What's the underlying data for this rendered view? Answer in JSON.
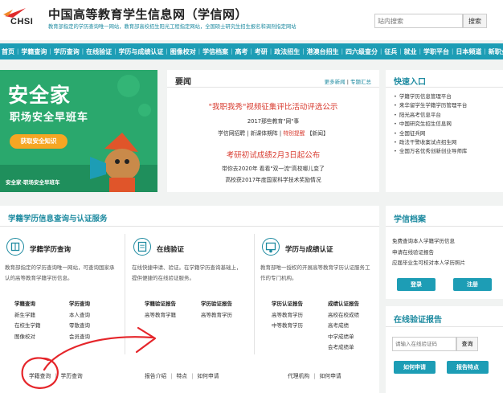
{
  "header": {
    "logo_text": "CHSI",
    "title": "中国高等教育学生信息网（学信网）",
    "subtitle": "教育部指定的学历查询唯一网站，教育部高校招生阳光工程指定网站，全国硕士研究生招生报名和调剂指定网站",
    "search_placeholder": "站内搜索",
    "search_button": "搜索"
  },
  "nav": [
    "首页",
    "学籍查询",
    "学历查询",
    "在线验证",
    "学历与成绩认证",
    "图像校对",
    "学信档案",
    "高考",
    "考研",
    "政法招生",
    "港澳台招生",
    "四六级查分",
    "征兵",
    "就业",
    "学职平台",
    "日本频道",
    "新职业"
  ],
  "banner": {
    "title": "安全家",
    "slogan": "职场安全早班车",
    "cta": "获取安全知识",
    "footer": "安全家·职场安全早班车"
  },
  "news": {
    "heading": "要闻",
    "more": "更多新闻",
    "topics": "专题汇总",
    "headline1": "\"我职我秀\"视频征集评比活动评选公示",
    "line1": "2017那些教育\"网\"事",
    "line2": [
      "学信网招聘",
      "新课体期阵",
      "特别提醒",
      "【新闻】"
    ],
    "headline2": "考研初试成绩2月3日起公布",
    "line3": "带你去2020年 看看\"双一流\"高校哪儿变了",
    "line4": "高校获2017年度国家科学技术奖励情况"
  },
  "quick": {
    "heading": "快速入口",
    "items": [
      "学籍学历信息管理平台",
      "来华留学生学籍学历管理平台",
      "阳光高考信息平台",
      "中国研究生招生信息网",
      "全国征兵网",
      "政法干警收案试点招生网",
      "全国万名优秀创新创业导师库"
    ]
  },
  "verify": {
    "heading": "学籍学历信息查询与认证服务",
    "columns": [
      {
        "title": "学籍学历查询",
        "desc": "教育部指定的学历查询唯一网站，可查询国家承认的高等教育学籍学历信息。",
        "links": [
          "学籍查询",
          "学历查询",
          "新生学籍",
          "本人查询",
          "在校生学籍",
          "零散查询",
          "图像校对",
          "会员查询"
        ],
        "footer": [
          "学籍查询",
          "学历查询"
        ]
      },
      {
        "title": "在线验证",
        "desc": "在线快捷申请、验证。在学籍学历查询基础上，提供便捷的在线验证服务。",
        "links": [
          "学籍验证报告",
          "学历验证报告",
          "高等教育学籍",
          "高等教育学历"
        ],
        "footer": [
          "报告介绍",
          "特点",
          "如何申请"
        ]
      },
      {
        "title": "学历与成绩认证",
        "desc": "教育部唯一授权的开展高等教育学历认证服务工作的专门机构。",
        "links": [
          "学历认证报告",
          "成绩认证报告",
          "高等教育学历",
          "高校在校成绩",
          "中等教育学历",
          "高考成绩",
          "",
          "中学成绩单",
          "",
          "会考成绩单"
        ],
        "footer": [
          "代理机构",
          "如何申请"
        ]
      }
    ]
  },
  "archive": {
    "heading": "学信档案",
    "lines": [
      "免费查询本人学籍学历信息",
      "申请在线验证报告",
      "应届毕业生可校对本人学历照片"
    ],
    "login": "登录",
    "register": "注册"
  },
  "report": {
    "heading": "在线验证报告",
    "placeholder": "请输入在线验证码",
    "query": "查询",
    "apply": "如何申请",
    "features": "报告特点"
  },
  "colors": {
    "teal": "#1d9db5",
    "red": "#d83b2f",
    "banner": "#2aa86d",
    "annotation": "#e5252a"
  }
}
